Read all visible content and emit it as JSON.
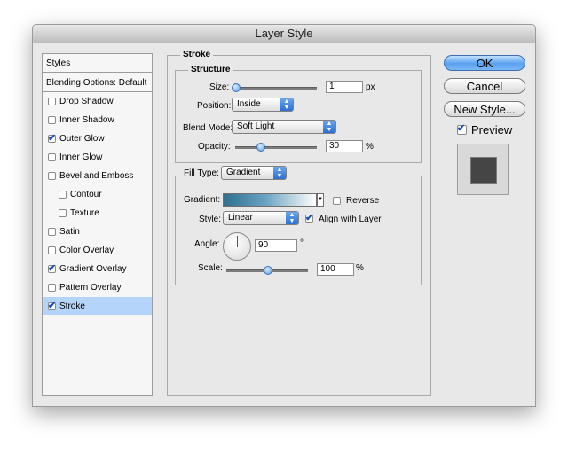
{
  "window": {
    "title": "Layer Style"
  },
  "styles_panel": {
    "header": "Styles",
    "blending_options": "Blending Options: Default",
    "items": [
      {
        "label": "Drop Shadow",
        "checked": false,
        "indent": false,
        "selected": false
      },
      {
        "label": "Inner Shadow",
        "checked": false,
        "indent": false,
        "selected": false
      },
      {
        "label": "Outer Glow",
        "checked": true,
        "indent": false,
        "selected": false
      },
      {
        "label": "Inner Glow",
        "checked": false,
        "indent": false,
        "selected": false
      },
      {
        "label": "Bevel and Emboss",
        "checked": false,
        "indent": false,
        "selected": false
      },
      {
        "label": "Contour",
        "checked": false,
        "indent": true,
        "selected": false
      },
      {
        "label": "Texture",
        "checked": false,
        "indent": true,
        "selected": false
      },
      {
        "label": "Satin",
        "checked": false,
        "indent": false,
        "selected": false
      },
      {
        "label": "Color Overlay",
        "checked": false,
        "indent": false,
        "selected": false
      },
      {
        "label": "Gradient Overlay",
        "checked": true,
        "indent": false,
        "selected": false
      },
      {
        "label": "Pattern Overlay",
        "checked": false,
        "indent": false,
        "selected": false
      },
      {
        "label": "Stroke",
        "checked": true,
        "indent": false,
        "selected": true
      }
    ]
  },
  "stroke": {
    "title": "Stroke",
    "structure": {
      "title": "Structure",
      "size_label": "Size:",
      "size_value": "1",
      "size_unit": "px",
      "size_level": 0.0,
      "position_label": "Position:",
      "position_value": "Inside",
      "blend_mode_label": "Blend Mode:",
      "blend_mode_value": "Soft Light",
      "opacity_label": "Opacity:",
      "opacity_value": "30",
      "opacity_unit": "%",
      "opacity_level": 0.3
    },
    "fill": {
      "fill_type_label": "Fill Type:",
      "fill_type_value": "Gradient",
      "gradient_label": "Gradient:",
      "reverse_label": "Reverse",
      "reverse_checked": false,
      "style_label": "Style:",
      "style_value": "Linear",
      "align_label": "Align with Layer",
      "align_checked": true,
      "angle_label": "Angle:",
      "angle_value": "90",
      "angle_unit": "°",
      "scale_label": "Scale:",
      "scale_value": "100",
      "scale_unit": "%",
      "scale_level": 0.5
    }
  },
  "buttons": {
    "ok": "OK",
    "cancel": "Cancel",
    "new_style": "New Style...",
    "preview": "Preview",
    "preview_checked": true
  },
  "colors": {
    "selection": "#b5d4fa",
    "accent_blue": "#5aa0ee",
    "preview_swatch": "#454545"
  }
}
